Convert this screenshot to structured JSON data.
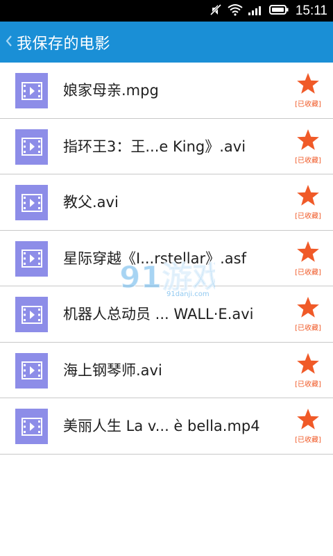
{
  "status_bar": {
    "time": "15:11"
  },
  "app_bar": {
    "title": "我保存的电影"
  },
  "colors": {
    "accent": "#1a8fd6",
    "star": "#f05a28",
    "thumb": "#8d8de8"
  },
  "list": {
    "items": [
      {
        "name": "娘家母亲.mpg",
        "fav_label": "[已收藏]"
      },
      {
        "name": "指环王3：王...e King》.avi",
        "fav_label": "[已收藏]"
      },
      {
        "name": "教父.avi",
        "fav_label": "[已收藏]"
      },
      {
        "name": "星际穿越《I...rstellar》.asf",
        "fav_label": "[已收藏]"
      },
      {
        "name": "机器人总动员 ... WALL·E.avi",
        "fav_label": "[已收藏]"
      },
      {
        "name": "海上钢琴师.avi",
        "fav_label": "[已收藏]"
      },
      {
        "name": "美丽人生 La v... è bella.mp4",
        "fav_label": "[已收藏]"
      }
    ]
  },
  "watermark": {
    "text": "91游戏",
    "subtext": "91danji.com"
  }
}
